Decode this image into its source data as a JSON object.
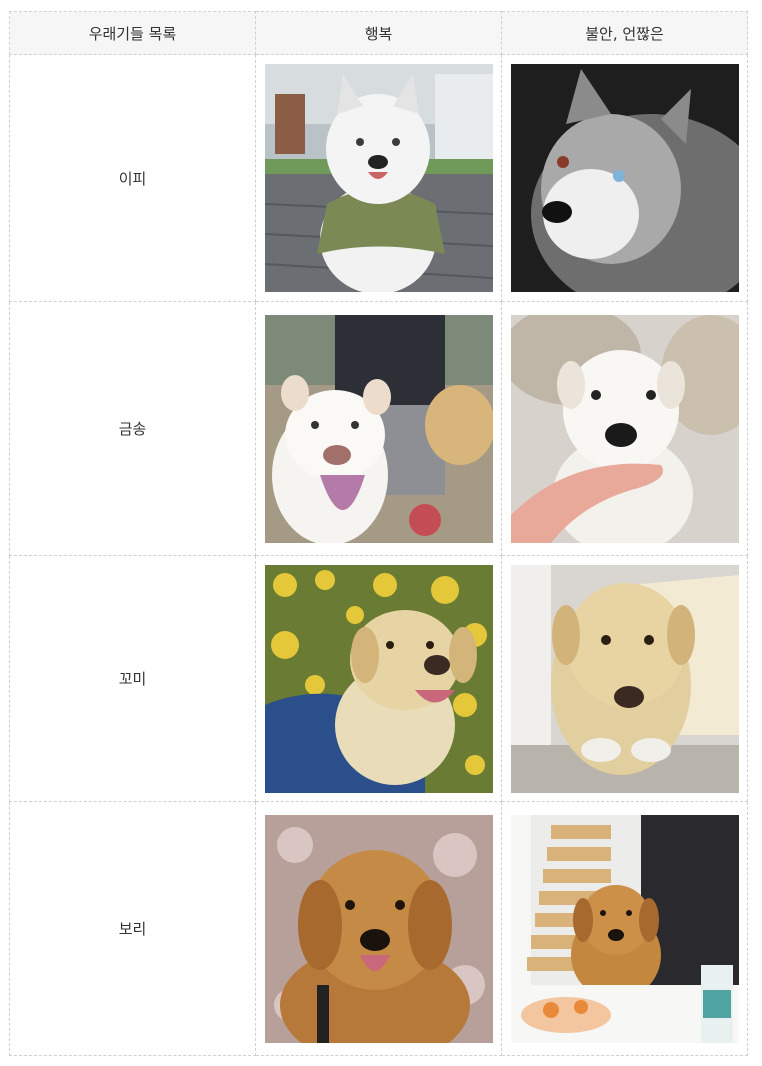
{
  "table": {
    "headers": [
      "우래기들 목록",
      "행복",
      "불안, 언짢은"
    ],
    "rows": [
      {
        "name": "이피",
        "happy_photo": "white-husky-in-green-vest-photo",
        "anxious_photo": "gray-husky-heterochromia-photo"
      },
      {
        "name": "금송",
        "happy_photo": "white-dog-tongue-out-photo",
        "anxious_photo": "white-dog-chin-in-hand-photo"
      },
      {
        "name": "꼬미",
        "happy_photo": "yellow-lab-blue-harness-photo",
        "anxious_photo": "yellow-lab-looking-up-photo"
      },
      {
        "name": "보리",
        "happy_photo": "golden-retriever-smiling-photo",
        "anxious_photo": "golden-retriever-by-stairs-photo"
      }
    ]
  }
}
